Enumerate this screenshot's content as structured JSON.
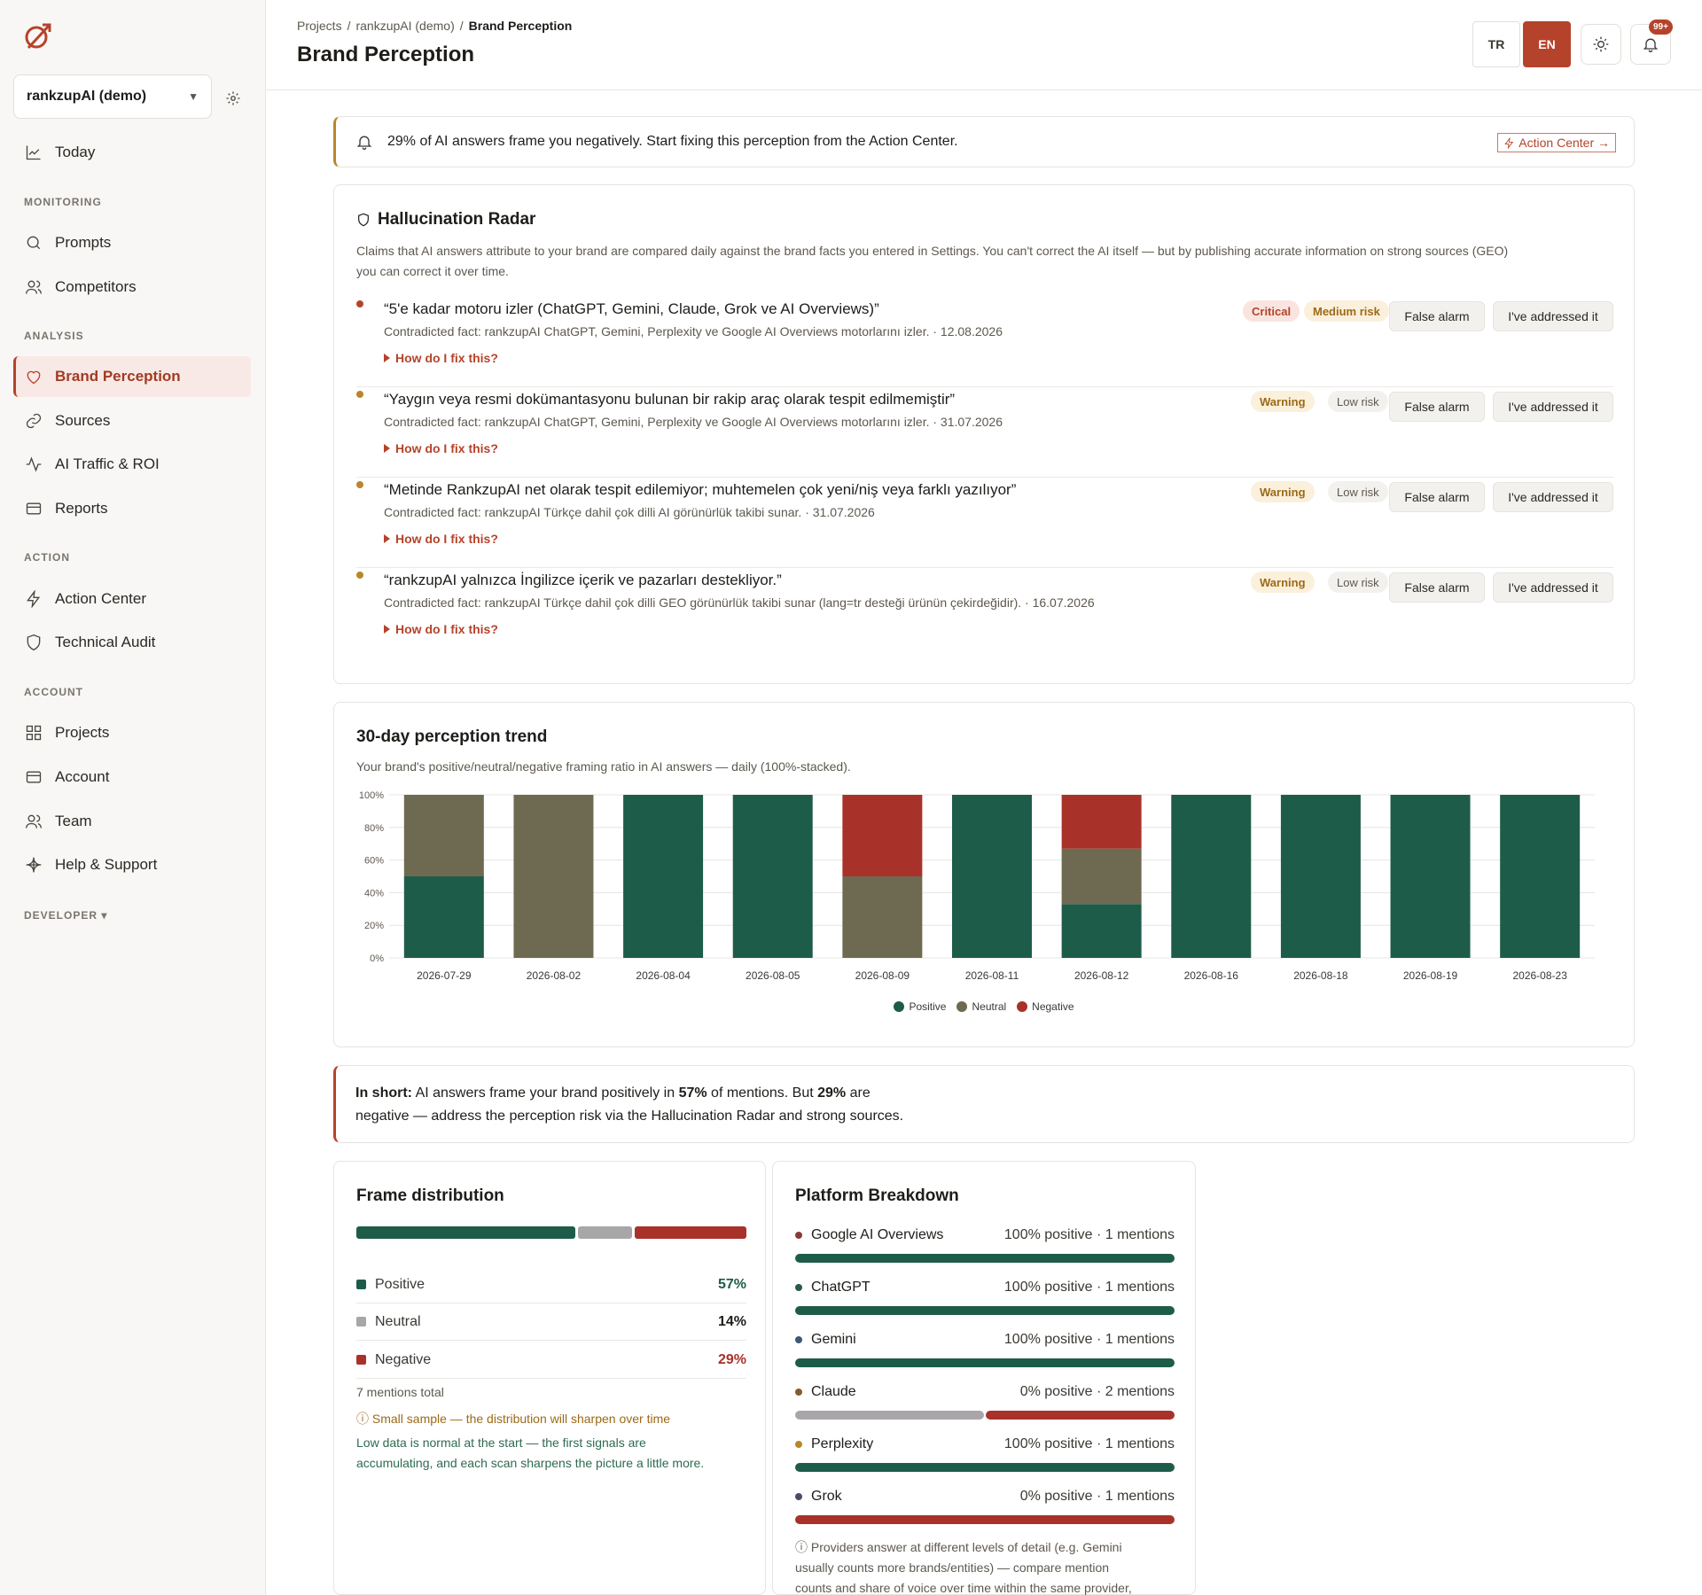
{
  "sidebar": {
    "project": "rankzupAI (demo)",
    "today": "Today",
    "sections": {
      "monitoring": "MONITORING",
      "analysis": "ANALYSIS",
      "action": "ACTION",
      "account": "ACCOUNT",
      "developer": "DEVELOPER ▾"
    },
    "items": {
      "prompts": "Prompts",
      "competitors": "Competitors",
      "brand_perception": "Brand Perception",
      "sources": "Sources",
      "ai_traffic": "AI Traffic & ROI",
      "reports": "Reports",
      "action_center": "Action Center",
      "technical_audit": "Technical Audit",
      "projects": "Projects",
      "account": "Account",
      "team": "Team",
      "help": "Help & Support"
    }
  },
  "header": {
    "breadcrumb": [
      "Projects",
      "/",
      "rankzupAI (demo)",
      "/",
      "Brand Perception"
    ],
    "title": "Brand Perception",
    "lang_tr": "TR",
    "lang_en": "EN",
    "notifications": "99+"
  },
  "alert": {
    "text": "29% of AI answers frame you negatively. Start fixing this perception from the Action Center.",
    "link": "Action Center →"
  },
  "radar": {
    "title": "Hallucination Radar",
    "desc1": "Claims that AI answers attribute to your brand are compared daily against the brand facts you entered in Settings. You can't correct the AI itself — but by publishing accurate information on strong sources (GEO)",
    "desc2": "you can correct it over time.",
    "fix_label": "How do I fix this?",
    "false_alarm": "False alarm",
    "addressed": "I've addressed it",
    "claims": [
      {
        "quote": "“5'e kadar motoru izler (ChatGPT, Gemini, Claude, Grok ve AI Overviews)”",
        "fact": "Contradicted fact: rankzupAI ChatGPT, Gemini, Perplexity ve Google AI Overviews motorlarını izler. · 12.08.2026",
        "severity": "Critical",
        "risk": "Medium risk",
        "color": "#b5432b"
      },
      {
        "quote": "“Yaygın veya resmi dokümantasyonu bulunan bir rakip araç olarak tespit edilmemiştir”",
        "fact": "Contradicted fact: rankzupAI ChatGPT, Gemini, Perplexity ve Google AI Overviews motorlarını izler. · 31.07.2026",
        "severity": "Warning",
        "risk": "Low risk",
        "color": "#b8862b"
      },
      {
        "quote": "“Metinde RankzupAI net olarak tespit edilemiyor; muhtemelen çok yeni/niş veya farklı yazılıyor”",
        "fact": "Contradicted fact: rankzupAI Türkçe dahil çok dilli AI görünürlük takibi sunar. · 31.07.2026",
        "severity": "Warning",
        "risk": "Low risk",
        "color": "#b8862b"
      },
      {
        "quote": "“rankzupAI yalnızca İngilizce içerik ve pazarları destekliyor.”",
        "fact": "Contradicted fact: rankzupAI Türkçe dahil çok dilli GEO görünürlük takibi sunar (lang=tr desteği ürünün çekirdeğidir). · 16.07.2026",
        "severity": "Warning",
        "risk": "Low risk",
        "color": "#b8862b"
      }
    ]
  },
  "trend": {
    "title": "30-day perception trend",
    "desc": "Your brand's positive/neutral/negative framing ratio in AI answers — daily (100%-stacked).",
    "legend": [
      "Positive",
      "Neutral",
      "Negative"
    ]
  },
  "chart_data": {
    "type": "bar",
    "stacked": true,
    "categories": [
      "2026-07-29",
      "2026-08-02",
      "2026-08-04",
      "2026-08-05",
      "2026-08-09",
      "2026-08-11",
      "2026-08-12",
      "2026-08-16",
      "2026-08-18",
      "2026-08-19",
      "2026-08-23"
    ],
    "series": [
      {
        "name": "Positive",
        "color": "#1e5c4a",
        "values": [
          50,
          0,
          100,
          100,
          0,
          100,
          33,
          100,
          100,
          100,
          100
        ]
      },
      {
        "name": "Neutral",
        "color": "#6e6a51",
        "values": [
          50,
          100,
          0,
          0,
          50,
          0,
          34,
          0,
          0,
          0,
          0
        ]
      },
      {
        "name": "Negative",
        "color": "#a8322a",
        "values": [
          0,
          0,
          0,
          0,
          50,
          0,
          33,
          0,
          0,
          0,
          0
        ]
      }
    ],
    "ylim": [
      0,
      100
    ],
    "yticks": [
      "0%",
      "20%",
      "40%",
      "60%",
      "80%",
      "100%"
    ],
    "grid": true,
    "legend_position": "bottom"
  },
  "short": {
    "lead": "In short:",
    "t1": " AI answers frame your brand positively in ",
    "pos": "57%",
    "t2": " of mentions. But ",
    "neg": "29%",
    "t3": " are",
    "t4": "negative — address the perception risk via the Hallucination Radar and strong sources."
  },
  "frame": {
    "title": "Frame distribution",
    "rows": [
      {
        "label": "Positive",
        "value": "57%",
        "pct": 57,
        "color": "#1e5c4a"
      },
      {
        "label": "Neutral",
        "value": "14%",
        "pct": 14,
        "color": "#a8a6a8"
      },
      {
        "label": "Negative",
        "value": "29%",
        "pct": 29,
        "color": "#a8322a"
      }
    ],
    "total": "7 mentions total",
    "small_sample": "ⓘ Small sample — the distribution will sharpen over time",
    "low_data1": "Low data is normal at the start — the first signals are",
    "low_data2": "accumulating, and each scan sharpens the picture a little more."
  },
  "platform": {
    "title": "Platform Breakdown",
    "rows": [
      {
        "name": "Google AI Overviews",
        "stat": "100% positive · 1 mentions",
        "dot": "#8a3a3a",
        "pos": 100,
        "neu": 0,
        "neg": 0
      },
      {
        "name": "ChatGPT",
        "stat": "100% positive · 1 mentions",
        "dot": "#2a5a48",
        "pos": 100,
        "neu": 0,
        "neg": 0
      },
      {
        "name": "Gemini",
        "stat": "100% positive · 1 mentions",
        "dot": "#3a5878",
        "pos": 100,
        "neu": 0,
        "neg": 0
      },
      {
        "name": "Claude",
        "stat": "0% positive · 2 mentions",
        "dot": "#8a5a2a",
        "pos": 0,
        "neu": 50,
        "neg": 50
      },
      {
        "name": "Perplexity",
        "stat": "100% positive · 1 mentions",
        "dot": "#b8862b",
        "pos": 100,
        "neu": 0,
        "neg": 0
      },
      {
        "name": "Grok",
        "stat": "0% positive · 1 mentions",
        "dot": "#4a4a68",
        "pos": 0,
        "neu": 0,
        "neg": 100
      }
    ],
    "note1": "ⓘ Providers answer at different levels of detail (e.g. Gemini",
    "note2": "usually counts more brands/entities) — compare mention",
    "note3": "counts and share of voice over time within the same provider,"
  }
}
